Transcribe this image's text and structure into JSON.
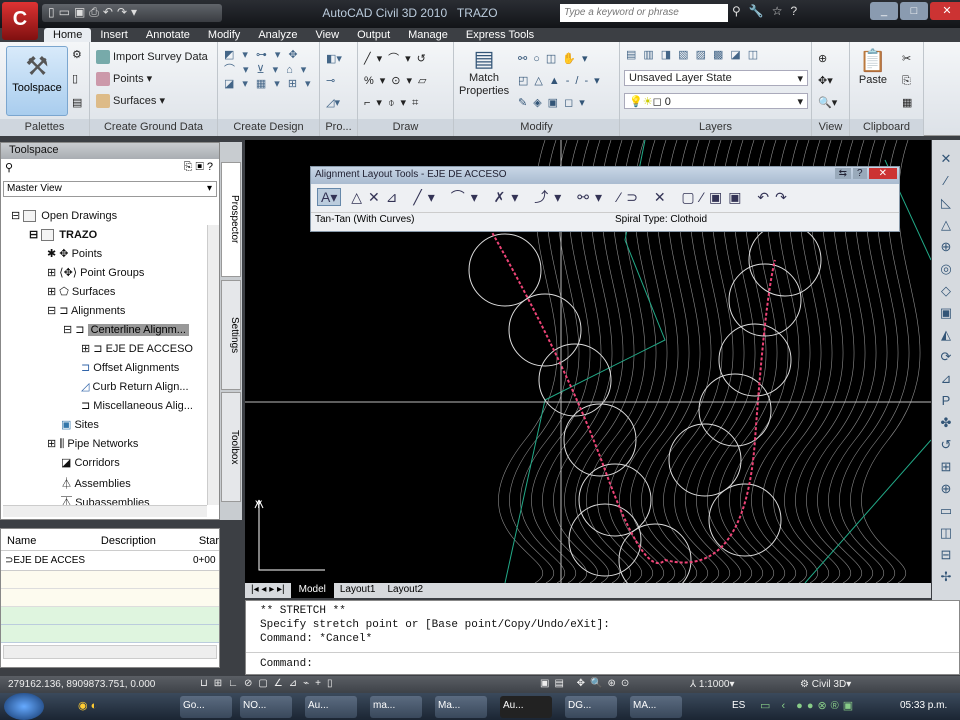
{
  "window": {
    "title": "AutoCAD Civil 3D 2010",
    "drawing": "TRAZO",
    "search_placeholder": "Type a keyword or phrase",
    "app_button": "C"
  },
  "tabs": [
    "Home",
    "Insert",
    "Annotate",
    "Modify",
    "Analyze",
    "View",
    "Output",
    "Manage",
    "Express Tools"
  ],
  "ribbon": {
    "toolspace": "Toolspace",
    "ground": [
      "Import Survey Data",
      "Points",
      "Surfaces"
    ],
    "match": "Match Properties",
    "layer_state": "Unsaved Layer State",
    "layer": "0",
    "paste": "Paste",
    "panels": [
      "Palettes",
      "Create Ground Data",
      "Create Design",
      "Pro...",
      "Draw",
      "Modify",
      "Layers",
      "View",
      "Clipboard"
    ]
  },
  "toolspace": {
    "title": "Toolspace",
    "view": "Master View",
    "tree": [
      "Open Drawings",
      "TRAZO",
      "Points",
      "Point Groups",
      "Surfaces",
      "Alignments",
      "Centerline Alignm...",
      "EJE DE ACCESO",
      "Offset Alignments",
      "Curb Return Align...",
      "Miscellaneous Alig...",
      "Sites",
      "Pipe Networks",
      "Corridors",
      "Assemblies",
      "Subassemblies"
    ],
    "side_tabs": [
      "Prospector",
      "Settings",
      "Toolbox"
    ]
  },
  "item_list": {
    "columns": [
      "Name",
      "Description",
      "Star"
    ],
    "rows": [
      {
        "name": "EJE DE ACCES",
        "description": "",
        "start": "0+00"
      }
    ]
  },
  "alignment_tools": {
    "title": "Alignment Layout Tools - EJE DE ACCESO",
    "mode": "Tan-Tan (With Curves)",
    "spiral": "Spiral Type: Clothoid"
  },
  "layout_tabs": [
    "Model",
    "Layout1",
    "Layout2"
  ],
  "command": {
    "lines": [
      "** STRETCH **",
      "Specify stretch point or [Base point/Copy/Undo/eXit]:",
      "Command: *Cancel*"
    ],
    "prompt": "Command:"
  },
  "status": {
    "coords": "279162.136, 8909873.751, 0.000",
    "scale": "1:1000",
    "workspace": "Civil 3D"
  },
  "taskbar": {
    "items": [
      "Go...",
      "NO...",
      "Au...",
      "ma...",
      "Ma...",
      "Au...",
      "DG...",
      "MA..."
    ],
    "lang": "ES",
    "time": "05:33 p.m."
  }
}
